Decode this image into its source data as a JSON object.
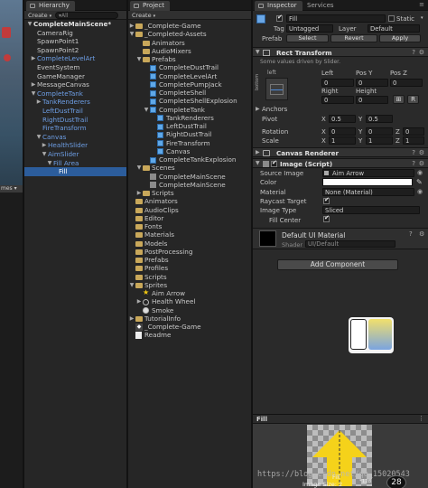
{
  "hierarchy": {
    "tab_label": "Hierarchy",
    "create_label": "Create",
    "search_placeholder": "▾All",
    "scene_name": "CompleteMainScene*",
    "items": [
      {
        "label": "CameraRig",
        "depth": 1,
        "blue": false,
        "arrow": ""
      },
      {
        "label": "SpawnPoint1",
        "depth": 1,
        "blue": false,
        "arrow": ""
      },
      {
        "label": "SpawnPoint2",
        "depth": 1,
        "blue": false,
        "arrow": ""
      },
      {
        "label": "CompleteLevelArt",
        "depth": 1,
        "blue": true,
        "arrow": "▶"
      },
      {
        "label": "EventSystem",
        "depth": 1,
        "blue": false,
        "arrow": ""
      },
      {
        "label": "GameManager",
        "depth": 1,
        "blue": false,
        "arrow": ""
      },
      {
        "label": "MessageCanvas",
        "depth": 1,
        "blue": false,
        "arrow": "▶"
      },
      {
        "label": "CompleteTank",
        "depth": 1,
        "blue": true,
        "arrow": "▼"
      },
      {
        "label": "TankRenderers",
        "depth": 2,
        "blue": true,
        "arrow": "▶"
      },
      {
        "label": "LeftDustTrail",
        "depth": 2,
        "blue": true,
        "arrow": ""
      },
      {
        "label": "RightDustTrail",
        "depth": 2,
        "blue": true,
        "arrow": ""
      },
      {
        "label": "FireTransform",
        "depth": 2,
        "blue": true,
        "arrow": ""
      },
      {
        "label": "Canvas",
        "depth": 2,
        "blue": true,
        "arrow": "▼"
      },
      {
        "label": "HealthSlider",
        "depth": 3,
        "blue": true,
        "arrow": "▶"
      },
      {
        "label": "AimSlider",
        "depth": 3,
        "blue": true,
        "arrow": "▼"
      },
      {
        "label": "Fill Area",
        "depth": 4,
        "blue": true,
        "arrow": "▼"
      },
      {
        "label": "Fill",
        "depth": 5,
        "blue": false,
        "arrow": "",
        "selected": true
      }
    ]
  },
  "project": {
    "tab_label": "Project",
    "create_label": "Create",
    "items": [
      {
        "label": "_Complete-Game",
        "depth": 0,
        "arrow": "▶",
        "icon": "folder"
      },
      {
        "label": "_Completed-Assets",
        "depth": 0,
        "arrow": "▼",
        "icon": "folder"
      },
      {
        "label": "Animators",
        "depth": 1,
        "arrow": "",
        "icon": "folder"
      },
      {
        "label": "AudioMixers",
        "depth": 1,
        "arrow": "",
        "icon": "folder"
      },
      {
        "label": "Prefabs",
        "depth": 1,
        "arrow": "▼",
        "icon": "folder"
      },
      {
        "label": "CompleteDustTrail",
        "depth": 2,
        "arrow": "",
        "icon": "prefab"
      },
      {
        "label": "CompleteLevelArt",
        "depth": 2,
        "arrow": "",
        "icon": "prefab"
      },
      {
        "label": "CompletePumpJack",
        "depth": 2,
        "arrow": "",
        "icon": "prefab"
      },
      {
        "label": "CompleteShell",
        "depth": 2,
        "arrow": "",
        "icon": "prefab"
      },
      {
        "label": "CompleteShellExplosion",
        "depth": 2,
        "arrow": "",
        "icon": "prefab"
      },
      {
        "label": "CompleteTank",
        "depth": 2,
        "arrow": "▼",
        "icon": "prefab"
      },
      {
        "label": "TankRenderers",
        "depth": 3,
        "arrow": "",
        "icon": "prefab"
      },
      {
        "label": "LeftDustTrail",
        "depth": 3,
        "arrow": "",
        "icon": "prefab"
      },
      {
        "label": "RightDustTrail",
        "depth": 3,
        "arrow": "",
        "icon": "prefab"
      },
      {
        "label": "FireTransform",
        "depth": 3,
        "arrow": "",
        "icon": "prefab"
      },
      {
        "label": "Canvas",
        "depth": 3,
        "arrow": "",
        "icon": "prefab"
      },
      {
        "label": "CompleteTankExplosion",
        "depth": 2,
        "arrow": "",
        "icon": "prefab"
      },
      {
        "label": "Scenes",
        "depth": 1,
        "arrow": "▼",
        "icon": "folder"
      },
      {
        "label": "CompleteMainScene",
        "depth": 2,
        "arrow": "",
        "icon": "scene"
      },
      {
        "label": "CompleteMainScene",
        "depth": 2,
        "arrow": "",
        "icon": "scene"
      },
      {
        "label": "Scripts",
        "depth": 1,
        "arrow": "▶",
        "icon": "folder"
      },
      {
        "label": "Animators",
        "depth": 0,
        "arrow": "",
        "icon": "folder"
      },
      {
        "label": "AudioClips",
        "depth": 0,
        "arrow": "",
        "icon": "folder"
      },
      {
        "label": "Editor",
        "depth": 0,
        "arrow": "",
        "icon": "folder"
      },
      {
        "label": "Fonts",
        "depth": 0,
        "arrow": "",
        "icon": "folder"
      },
      {
        "label": "Materials",
        "depth": 0,
        "arrow": "",
        "icon": "folder"
      },
      {
        "label": "Models",
        "depth": 0,
        "arrow": "",
        "icon": "folder"
      },
      {
        "label": "PostProcessing",
        "depth": 0,
        "arrow": "",
        "icon": "folder"
      },
      {
        "label": "Prefabs",
        "depth": 0,
        "arrow": "",
        "icon": "folder"
      },
      {
        "label": "Profiles",
        "depth": 0,
        "arrow": "",
        "icon": "folder"
      },
      {
        "label": "Scripts",
        "depth": 0,
        "arrow": "",
        "icon": "folder"
      },
      {
        "label": "Sprites",
        "depth": 0,
        "arrow": "▼",
        "icon": "folder"
      },
      {
        "label": "Aim Arrow",
        "depth": 1,
        "arrow": "",
        "icon": "star"
      },
      {
        "label": "Health Wheel",
        "depth": 1,
        "arrow": "▶",
        "icon": "circle"
      },
      {
        "label": "Smoke",
        "depth": 1,
        "arrow": "",
        "icon": "circle-fill"
      },
      {
        "label": "TutorialInfo",
        "depth": 0,
        "arrow": "▶",
        "icon": "folder"
      },
      {
        "label": "_Complete-Game",
        "depth": 0,
        "arrow": "",
        "icon": "csharp"
      },
      {
        "label": "Readme",
        "depth": 0,
        "arrow": "",
        "icon": "doc"
      }
    ]
  },
  "inspector": {
    "tab_label": "Inspector",
    "services_label": "Services",
    "object_name": "Fill",
    "static_label": "Static",
    "tag_label": "Tag",
    "tag_value": "Untagged",
    "layer_label": "Layer",
    "layer_value": "Default",
    "prefab_label": "Prefab",
    "prefab_select": "Select",
    "prefab_revert": "Revert",
    "prefab_apply": "Apply",
    "rect_transform": {
      "title": "Rect Transform",
      "note": "Some values driven by Slider.",
      "anchor_preset_top": "left",
      "anchor_preset_side": "bottom",
      "left_label": "Left",
      "left_value": "0",
      "posy_label": "Pos Y",
      "posy_value": "0",
      "posz_label": "Pos Z",
      "posz_value": "0",
      "right_label": "Right",
      "right_value": "0",
      "height_label": "Height",
      "height_value": "0",
      "blueprint_btn": "⊞",
      "raw_btn": "R",
      "anchors_label": "Anchors",
      "pivot_label": "Pivot",
      "pivot_x": "0.5",
      "pivot_y": "0.5",
      "rotation_label": "Rotation",
      "rot_x": "0",
      "rot_y": "0",
      "rot_z": "0",
      "scale_label": "Scale",
      "scale_x": "1",
      "scale_y": "1",
      "scale_z": "1",
      "axis_x": "X",
      "axis_y": "Y",
      "axis_z": "Z"
    },
    "canvas_renderer": {
      "title": "Canvas Renderer"
    },
    "image": {
      "title": "Image (Script)",
      "source_image_label": "Source Image",
      "source_image_value": "Aim Arrow",
      "color_label": "Color",
      "material_label": "Material",
      "material_value": "None (Material)",
      "raycast_label": "Raycast Target",
      "image_type_label": "Image Type",
      "image_type_value": "Sliced",
      "fill_center_label": "Fill Center"
    },
    "material_block": {
      "name": "Default UI Material",
      "shader_label": "Shader",
      "shader_value": "UI/Default"
    },
    "add_component": "Add Component",
    "preview": {
      "title": "Fill",
      "caption_name": "Fill",
      "caption_size": "Image Size: 2",
      "caption_size2": "*128"
    }
  },
  "watermark": "https://blog.csdn.net/qq_15020543",
  "colors": {
    "accent_blue": "#2c5d9c",
    "prefab_blue": "#6e9fe6",
    "arrow_yellow": "#f5d21a"
  }
}
